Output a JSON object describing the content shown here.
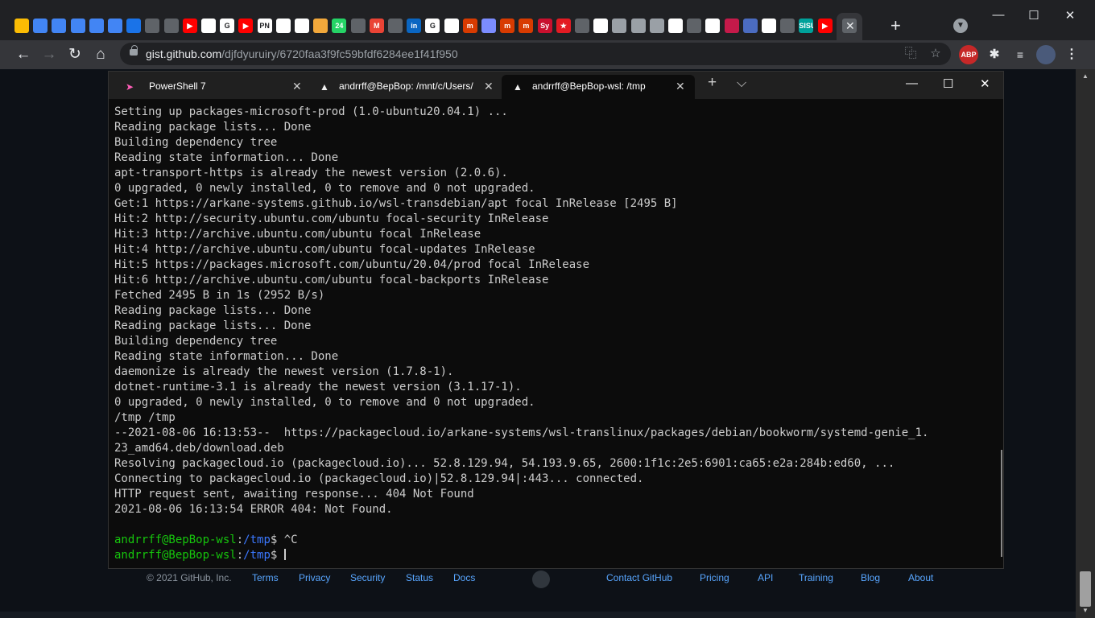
{
  "chrome": {
    "tab_close": "✕",
    "new_tab": "+",
    "tab_search": "▼",
    "win_min": "—",
    "win_max": "☐",
    "win_close": "✕",
    "favicons": [
      {
        "label": "",
        "color": "#fbbc04"
      },
      {
        "label": "",
        "color": "#4285f4"
      },
      {
        "label": "",
        "color": "#4285f4"
      },
      {
        "label": "",
        "color": "#4285f4"
      },
      {
        "label": "",
        "color": "#4285f4"
      },
      {
        "label": "",
        "color": "#4285f4"
      },
      {
        "label": "",
        "color": "#1a73e8"
      },
      {
        "label": "",
        "color": "#5f6368"
      },
      {
        "label": "",
        "color": "#5f6368"
      },
      {
        "label": "▶",
        "color": "#ff0000"
      },
      {
        "label": "",
        "color": "#ffffff"
      },
      {
        "label": "G",
        "color": "#ffffff"
      },
      {
        "label": "▶",
        "color": "#ff0000"
      },
      {
        "label": "PN",
        "color": "#ffffff"
      },
      {
        "label": "",
        "color": "#ffffff"
      },
      {
        "label": "",
        "color": "#ffffff"
      },
      {
        "label": "",
        "color": "#f2a83b"
      },
      {
        "label": "24",
        "color": "#25d366"
      },
      {
        "label": "",
        "color": "#5f6368"
      },
      {
        "label": "M",
        "color": "#ea4335"
      },
      {
        "label": "",
        "color": "#5f6368"
      },
      {
        "label": "in",
        "color": "#0a66c2"
      },
      {
        "label": "G",
        "color": "#ffffff"
      },
      {
        "label": "",
        "color": "#ffffff"
      },
      {
        "label": "m",
        "color": "#d83b01"
      },
      {
        "label": "",
        "color": "#7b8cff"
      },
      {
        "label": "m",
        "color": "#d83b01"
      },
      {
        "label": "m",
        "color": "#d83b01"
      },
      {
        "label": "Sy",
        "color": "#c8102e"
      },
      {
        "label": "★",
        "color": "#e31b23"
      },
      {
        "label": "",
        "color": "#5f6368"
      },
      {
        "label": "",
        "color": "#ffffff"
      },
      {
        "label": "",
        "color": "#9aa0a6"
      },
      {
        "label": "",
        "color": "#9aa0a6"
      },
      {
        "label": "",
        "color": "#9aa0a6"
      },
      {
        "label": "",
        "color": "#ffffff"
      },
      {
        "label": "",
        "color": "#5f6368"
      },
      {
        "label": "",
        "color": "#ffffff"
      },
      {
        "label": "",
        "color": "#c51a4a"
      },
      {
        "label": "",
        "color": "#4b6cc1"
      },
      {
        "label": "",
        "color": "#ffffff"
      },
      {
        "label": "",
        "color": "#5f6368"
      },
      {
        "label": "SISU",
        "color": "#00a19a"
      },
      {
        "label": "▶",
        "color": "#ff0000"
      }
    ],
    "url_host": "gist.github.com",
    "url_path": "/djfdyuruiry/6720faa3f9fc59bfdf6284ee1f41f950",
    "ext_abp": "ABP"
  },
  "terminal": {
    "tabs": [
      {
        "title": "PowerShell 7",
        "active": false
      },
      {
        "title": "andrrff@BepBop: /mnt/c/Users/",
        "active": false
      },
      {
        "title": "andrrff@BepBop-wsl: /tmp",
        "active": true
      }
    ],
    "tab_close": "✕",
    "new_tab": "+",
    "dropdown": "⌵",
    "win_min": "—",
    "win_max": "☐",
    "win_close": "✕",
    "lines": [
      "Setting up packages-microsoft-prod (1.0-ubuntu20.04.1) ...",
      "Reading package lists... Done",
      "Building dependency tree",
      "Reading state information... Done",
      "apt-transport-https is already the newest version (2.0.6).",
      "0 upgraded, 0 newly installed, 0 to remove and 0 not upgraded.",
      "Get:1 https://arkane-systems.github.io/wsl-transdebian/apt focal InRelease [2495 B]",
      "Hit:2 http://security.ubuntu.com/ubuntu focal-security InRelease",
      "Hit:3 http://archive.ubuntu.com/ubuntu focal InRelease",
      "Hit:4 http://archive.ubuntu.com/ubuntu focal-updates InRelease",
      "Hit:5 https://packages.microsoft.com/ubuntu/20.04/prod focal InRelease",
      "Hit:6 http://archive.ubuntu.com/ubuntu focal-backports InRelease",
      "Fetched 2495 B in 1s (2952 B/s)",
      "Reading package lists... Done",
      "Reading package lists... Done",
      "Building dependency tree",
      "Reading state information... Done",
      "daemonize is already the newest version (1.7.8-1).",
      "dotnet-runtime-3.1 is already the newest version (3.1.17-1).",
      "0 upgraded, 0 newly installed, 0 to remove and 0 not upgraded.",
      "/tmp /tmp",
      "--2021-08-06 16:13:53--  https://packagecloud.io/arkane-systems/wsl-translinux/packages/debian/bookworm/systemd-genie_1.",
      "23_amd64.deb/download.deb",
      "Resolving packagecloud.io (packagecloud.io)... 52.8.129.94, 54.193.9.65, 2600:1f1c:2e5:6901:ca65:e2a:284b:ed60, ...",
      "Connecting to packagecloud.io (packagecloud.io)|52.8.129.94|:443... connected.",
      "HTTP request sent, awaiting response... 404 Not Found",
      "2021-08-06 16:13:54 ERROR 404: Not Found.",
      ""
    ],
    "prompt_user": "andrrff@BepBop-wsl",
    "prompt_sep": ":",
    "prompt_dir": "/tmp",
    "prompt_sign": "$ ",
    "prompt1_cmd": "^C",
    "prompt2_cmd": ""
  },
  "footer": {
    "copyright": "© 2021 GitHub, Inc.",
    "links": [
      "Terms",
      "Privacy",
      "Security",
      "Status",
      "Docs",
      "Contact GitHub",
      "Pricing",
      "API",
      "Training",
      "Blog",
      "About"
    ]
  }
}
